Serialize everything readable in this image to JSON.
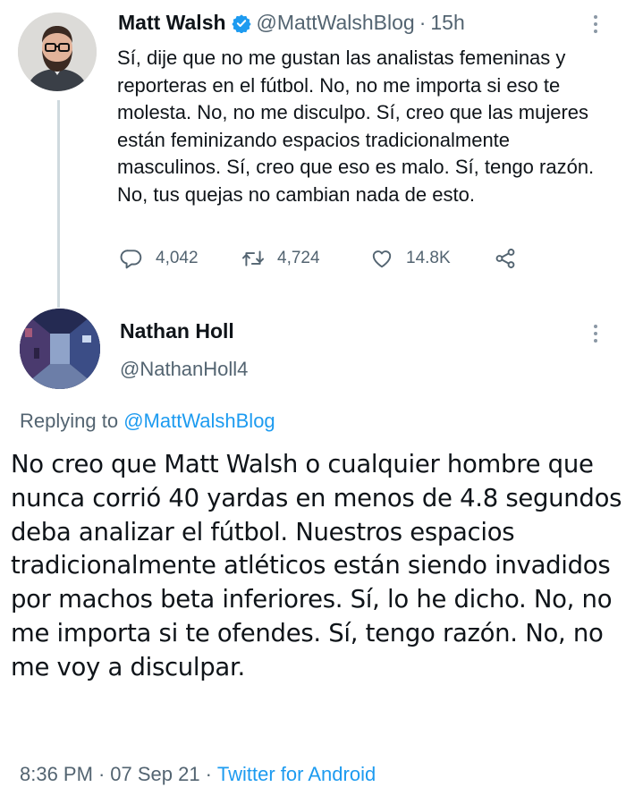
{
  "tweet": {
    "author_name": "Matt Walsh",
    "author_handle": "@MattWalshBlog",
    "separator": "·",
    "time_ago": "15h",
    "text": "Sí, dije que no me gustan las analistas femeninas y reporteras en el fútbol. No, no me importa si eso te molesta. No, no me disculpo. Sí, creo que las mujeres están feminizando espacios tradicionalmente masculinos. Sí, creo que eso es malo. Sí, tengo razón. No, tus quejas no cambian nada de esto.",
    "reply_count": "4,042",
    "retweet_count": "4,724",
    "like_count": "14.8K",
    "icons": [
      "verified-badge-icon",
      "more-options-icon",
      "reply-icon",
      "retweet-icon",
      "like-icon",
      "share-icon"
    ]
  },
  "reply": {
    "author_name": "Nathan Holl",
    "author_handle": "@NathanHoll4",
    "replying_prefix": "Replying to",
    "replying_to": "@MattWalshBlog",
    "text": "No creo que Matt Walsh o cualquier hombre que nunca corrió 40 yardas en menos de 4.8 segundos deba analizar el fútbol. Nuestros espacios tradicionalmente atléticos están siendo invadidos por machos beta inferiores. Sí, lo he dicho. No, no me importa si te ofendes. Sí, tengo razón. No, no me voy a disculpar.",
    "time": "8:36 PM",
    "separator1": "·",
    "date": "07 Sep 21",
    "separator2": "·",
    "source": "Twitter for Android"
  },
  "colors": {
    "accent": "#1d9bf0",
    "secondary_text": "#536471",
    "primary_text": "#0f1419",
    "thread_line": "#cfd9de"
  }
}
